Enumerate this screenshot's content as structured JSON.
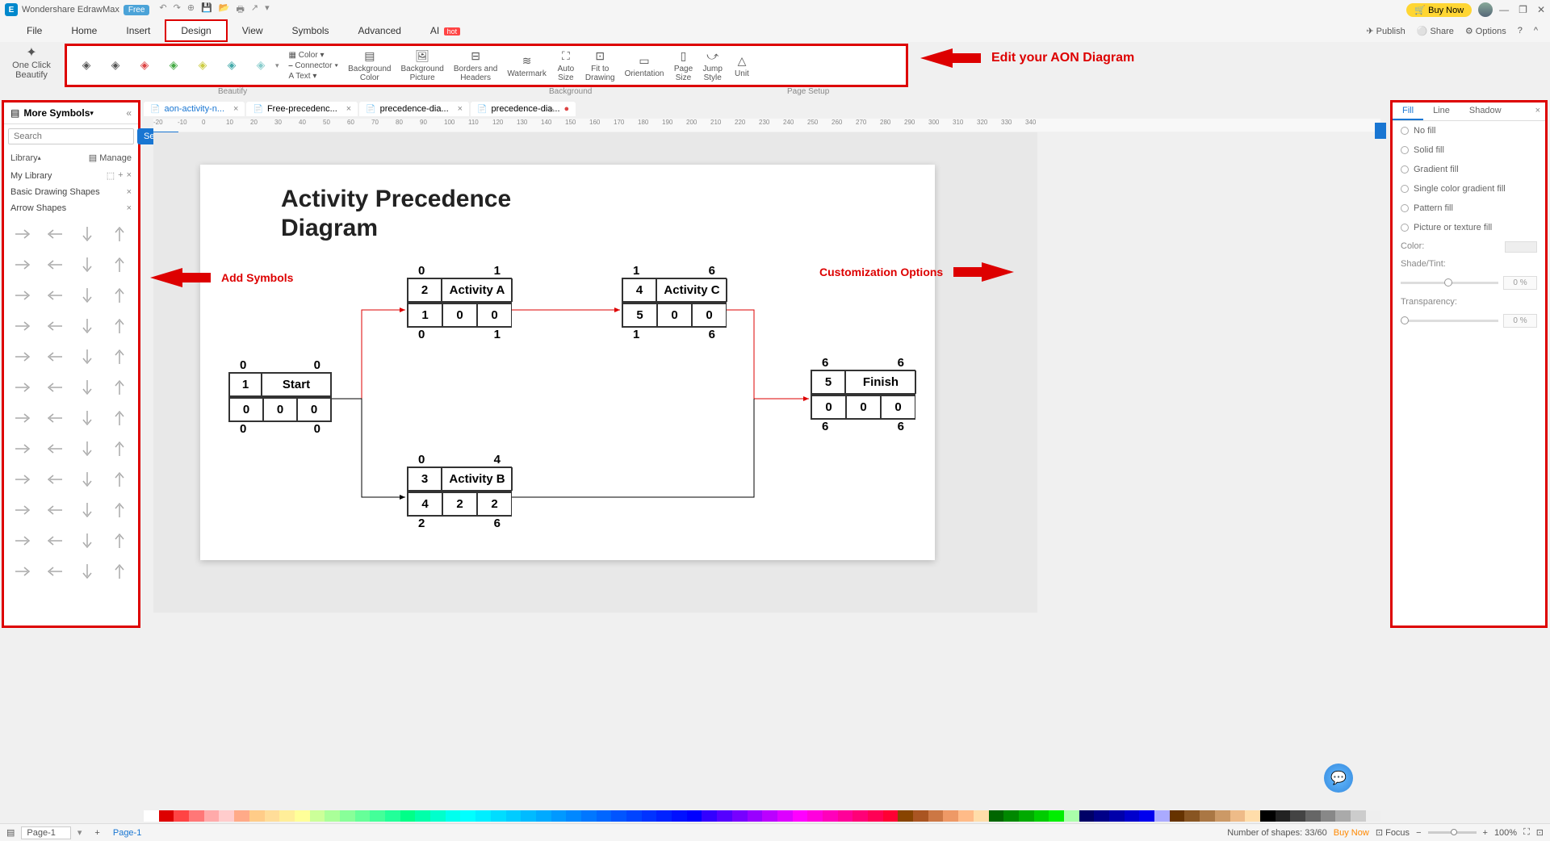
{
  "titlebar": {
    "app_name": "Wondershare EdrawMax",
    "free_badge": "Free",
    "buy_now": "Buy Now"
  },
  "menu": {
    "items": [
      "File",
      "Home",
      "Insert",
      "Design",
      "View",
      "Symbols",
      "Advanced",
      "AI"
    ],
    "active_index": 3,
    "right": [
      "Publish",
      "Share",
      "Options"
    ]
  },
  "ribbon": {
    "one_click": "One Click\nBeautify",
    "color": "Color",
    "connector": "Connector",
    "text": "Text",
    "bg_color": "Background\nColor",
    "bg_picture": "Background\nPicture",
    "borders": "Borders and\nHeaders",
    "watermark": "Watermark",
    "auto_size": "Auto\nSize",
    "fit_drawing": "Fit to\nDrawing",
    "orientation": "Orientation",
    "page_size": "Page\nSize",
    "jump_style": "Jump\nStyle",
    "unit": "Unit",
    "group_labels": {
      "beautify": "Beautify",
      "background": "Background",
      "page_setup": "Page Setup"
    }
  },
  "annotations": {
    "edit": "Edit your AON Diagram",
    "add_symbols": "Add Symbols",
    "customization": "Customization Options"
  },
  "left_panel": {
    "title": "More Symbols",
    "search_placeholder": "Search",
    "search_btn": "Search",
    "library": "Library",
    "manage": "Manage",
    "my_library": "My Library",
    "basic_shapes": "Basic Drawing Shapes",
    "arrow_shapes": "Arrow Shapes"
  },
  "doc_tabs": [
    {
      "label": "aon-activity-n...",
      "active": true,
      "dirty": false
    },
    {
      "label": "Free-precedenc...",
      "active": false,
      "dirty": false
    },
    {
      "label": "precedence-dia...",
      "active": false,
      "dirty": false
    },
    {
      "label": "precedence-dia...",
      "active": false,
      "dirty": true
    }
  ],
  "ruler_marks": [
    "-20",
    "-10",
    "0",
    "10",
    "20",
    "30",
    "40",
    "50",
    "60",
    "70",
    "80",
    "90",
    "100",
    "110",
    "120",
    "130",
    "140",
    "150",
    "160",
    "170",
    "180",
    "190",
    "200",
    "210",
    "220",
    "230",
    "240",
    "250",
    "260",
    "270",
    "280",
    "290",
    "300",
    "310",
    "320",
    "330",
    "340"
  ],
  "diagram": {
    "title": "Activity Precedence\nDiagram",
    "nodes": {
      "start": {
        "tl": "0",
        "tr": "0",
        "id": "1",
        "name": "Start",
        "b1": "0",
        "b2": "0",
        "b3": "0",
        "bl": "0",
        "br": "0"
      },
      "a": {
        "tl": "0",
        "tr": "1",
        "id": "2",
        "name": "Activity A",
        "b1": "1",
        "b2": "0",
        "b3": "0",
        "bl": "0",
        "br": "1"
      },
      "b": {
        "tl": "0",
        "tr": "4",
        "id": "3",
        "name": "Activity B",
        "b1": "4",
        "b2": "2",
        "b3": "2",
        "bl": "2",
        "br": "6"
      },
      "c": {
        "tl": "1",
        "tr": "6",
        "id": "4",
        "name": "Activity C",
        "b1": "5",
        "b2": "0",
        "b3": "0",
        "bl": "1",
        "br": "6"
      },
      "finish": {
        "tl": "6",
        "tr": "6",
        "id": "5",
        "name": "Finish",
        "b1": "0",
        "b2": "0",
        "b3": "0",
        "bl": "6",
        "br": "6"
      }
    }
  },
  "right_panel": {
    "tabs": [
      "Fill",
      "Line",
      "Shadow"
    ],
    "active_tab": 0,
    "options": [
      "No fill",
      "Solid fill",
      "Gradient fill",
      "Single color gradient fill",
      "Pattern fill",
      "Picture or texture fill"
    ],
    "color_label": "Color:",
    "shade_label": "Shade/Tint:",
    "shade_val": "0 %",
    "trans_label": "Transparency:",
    "trans_val": "0 %"
  },
  "status": {
    "page_sel": "Page-1",
    "page_tab": "Page-1",
    "shapes": "Number of shapes: 33/60",
    "buy_now": "Buy Now",
    "focus": "Focus",
    "zoom": "100%"
  },
  "colors": [
    "#fff",
    "#d00",
    "#f44",
    "#f77",
    "#faa",
    "#fcc",
    "#fa8",
    "#fc8",
    "#fd9",
    "#fe9",
    "#ff9",
    "#cf9",
    "#af9",
    "#8f9",
    "#6f9",
    "#4f9",
    "#2f9",
    "#0f8",
    "#0fa",
    "#0fc",
    "#0fe",
    "#0ff",
    "#0ef",
    "#0df",
    "#0cf",
    "#0bf",
    "#0af",
    "#09f",
    "#08f",
    "#07f",
    "#06f",
    "#05f",
    "#04f",
    "#03f",
    "#02f",
    "#01f",
    "#00f",
    "#30f",
    "#50f",
    "#70f",
    "#90f",
    "#b0f",
    "#d0f",
    "#f0f",
    "#f0d",
    "#f0b",
    "#f09",
    "#f07",
    "#f05",
    "#f03",
    "#840",
    "#a52",
    "#c74",
    "#e96",
    "#fb8",
    "#fda",
    "#060",
    "#080",
    "#0a0",
    "#0c0",
    "#0e0",
    "#afa",
    "#006",
    "#008",
    "#00a",
    "#00c",
    "#00e",
    "#aaf",
    "#630",
    "#852",
    "#a74",
    "#c96",
    "#eb8",
    "#fda",
    "#000",
    "#222",
    "#444",
    "#666",
    "#888",
    "#aaa",
    "#ccc",
    "#eee"
  ]
}
